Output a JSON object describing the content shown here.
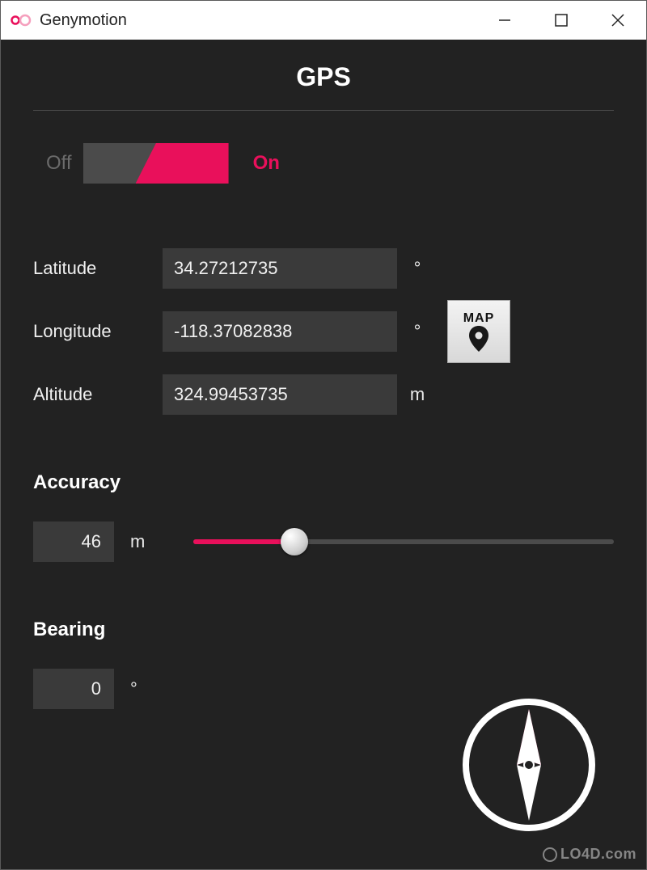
{
  "window": {
    "title": "Genymotion"
  },
  "header": {
    "title": "GPS"
  },
  "toggle": {
    "off_label": "Off",
    "on_label": "On",
    "state": "on"
  },
  "fields": {
    "latitude": {
      "label": "Latitude",
      "value": "34.27212735",
      "unit": "°"
    },
    "longitude": {
      "label": "Longitude",
      "value": "-118.37082838",
      "unit": "°"
    },
    "altitude": {
      "label": "Altitude",
      "value": "324.99453735",
      "unit": "m"
    }
  },
  "map_button": {
    "label": "MAP"
  },
  "accuracy": {
    "label": "Accuracy",
    "value": "46",
    "unit": "m",
    "slider_percent": 24
  },
  "bearing": {
    "label": "Bearing",
    "value": "0",
    "unit": "°"
  },
  "watermark": "LO4D.com"
}
